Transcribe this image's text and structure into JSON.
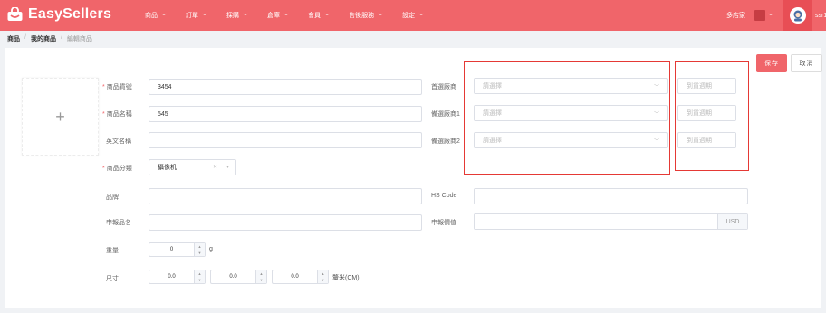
{
  "app": {
    "title": "EasySellers"
  },
  "nav": {
    "items": [
      {
        "label": "商品"
      },
      {
        "label": "訂單"
      },
      {
        "label": "採購"
      },
      {
        "label": "倉庫"
      },
      {
        "label": "會員"
      },
      {
        "label": "售後服務"
      },
      {
        "label": "設定"
      }
    ]
  },
  "topbar": {
    "store_label": "多店家",
    "user_name": "ssr11"
  },
  "breadcrumb": {
    "items": [
      "商品",
      "我的商品",
      "編輯商品"
    ],
    "separator": "/"
  },
  "toolbar": {
    "save_label": "保存",
    "cancel_label": "取消"
  },
  "form": {
    "product_code": {
      "label": "商品貨號",
      "value": "3454"
    },
    "product_name": {
      "label": "商品名稱",
      "value": "545"
    },
    "english_name": {
      "label": "英文名稱",
      "value": ""
    },
    "category": {
      "label": "商品分類",
      "value": "攝像机"
    },
    "brand": {
      "label": "品牌",
      "value": ""
    },
    "declared_name": {
      "label": "申報品名",
      "value": ""
    },
    "weight": {
      "label": "重量",
      "value": "0",
      "unit": "g"
    },
    "size": {
      "label": "尺寸",
      "length": "0.0",
      "width": "0.0",
      "height": "0.0",
      "unit": "釐米(CM)"
    },
    "primary_supplier": {
      "label": "首選廠商",
      "placeholder": "請選擇",
      "period_placeholder": "到貨週期"
    },
    "backup_supplier_1": {
      "label": "備選廠商1",
      "placeholder": "請選擇",
      "period_placeholder": "到貨週期"
    },
    "backup_supplier_2": {
      "label": "備選廠商2",
      "placeholder": "請選擇",
      "period_placeholder": "到貨週期"
    },
    "hs_code": {
      "label": "HS Code",
      "value": ""
    },
    "declared_value": {
      "label": "申報價值",
      "value": "",
      "currency": "USD"
    }
  },
  "icons": {
    "plus": "+",
    "chevron": "﹀"
  },
  "colors": {
    "brand": "#f0656a",
    "highlight_box": "#e53935"
  }
}
